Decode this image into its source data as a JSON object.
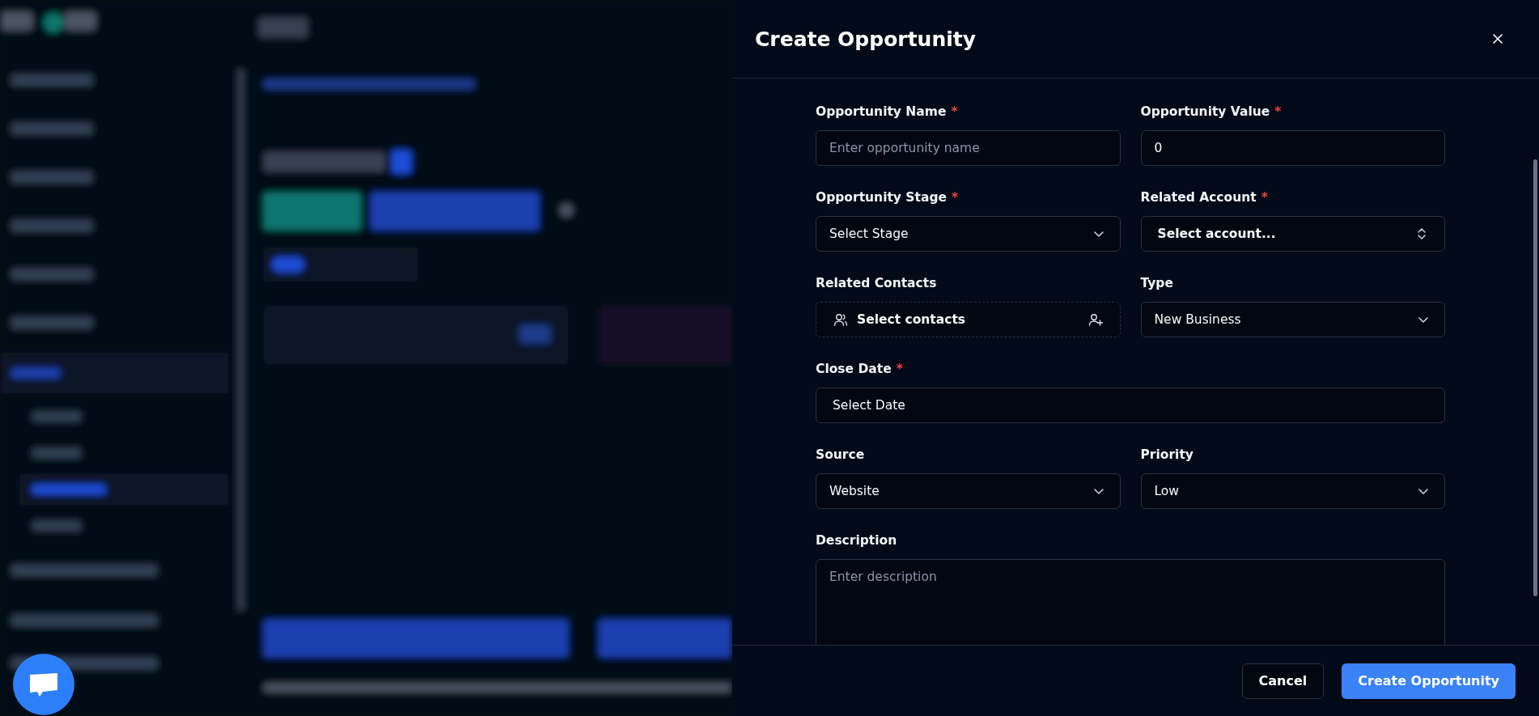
{
  "drawer": {
    "title": "Create Opportunity"
  },
  "rows": [
    [
      {
        "kind": "text",
        "label": "Opportunity Name",
        "required_mark": "*",
        "placeholder": "Enter opportunity name"
      },
      {
        "kind": "text",
        "label": "Opportunity Value",
        "required_mark": "*",
        "value": "0"
      }
    ],
    [
      {
        "kind": "select",
        "label": "Opportunity Stage",
        "required_mark": "*",
        "value": "Select Stage"
      },
      {
        "kind": "combobox",
        "label": "Related Account",
        "required_mark": "*",
        "value": "Select account..."
      }
    ],
    [
      {
        "kind": "contacts",
        "label": "Related Contacts",
        "value": "Select contacts"
      },
      {
        "kind": "select",
        "label": "Type",
        "value": "New Business"
      }
    ],
    [
      {
        "kind": "date",
        "label": "Close Date",
        "required_mark": "*",
        "value": "Select Date"
      }
    ],
    [
      {
        "kind": "select",
        "label": "Source",
        "value": "Website"
      },
      {
        "kind": "select",
        "label": "Priority",
        "value": "Low"
      }
    ],
    [
      {
        "kind": "textarea",
        "label": "Description",
        "placeholder": "Enter description"
      }
    ]
  ],
  "buttons": [
    {
      "kind": "secondary",
      "label": "Cancel"
    },
    {
      "kind": "primary",
      "label": "Create Opportunity"
    }
  ]
}
